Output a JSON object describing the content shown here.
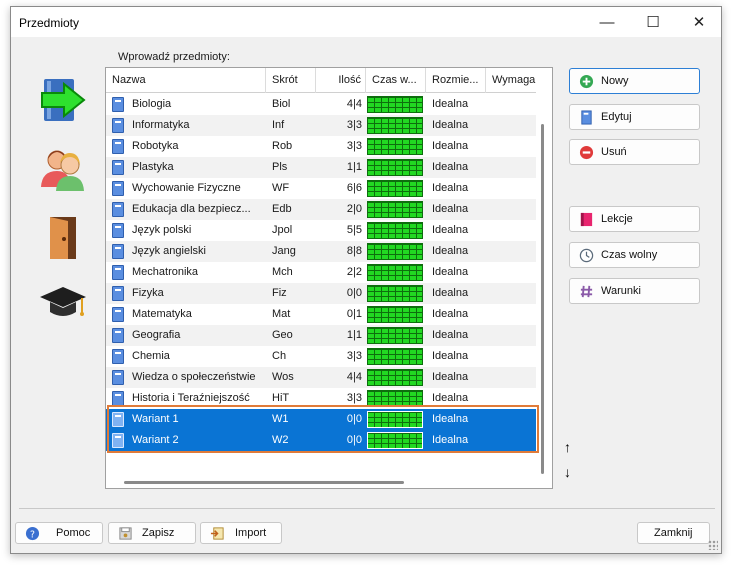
{
  "window": {
    "title": "Przedmioty"
  },
  "titlebar": {
    "minimize": "—",
    "maximize": "☐",
    "close": "✕"
  },
  "list": {
    "label": "Wprowadź przedmioty:",
    "columns": [
      "Nazwa",
      "Skrót",
      "Ilość",
      "Czas w...",
      "Rozmie...",
      "Wymaga"
    ],
    "rows": [
      {
        "name": "Biologia",
        "short": "Biol",
        "count": "4|4",
        "size": "Idealna"
      },
      {
        "name": "Informatyka",
        "short": "Inf",
        "count": "3|3",
        "size": "Idealna"
      },
      {
        "name": "Robotyka",
        "short": "Rob",
        "count": "3|3",
        "size": "Idealna"
      },
      {
        "name": "Plastyka",
        "short": "Pls",
        "count": "1|1",
        "size": "Idealna"
      },
      {
        "name": "Wychowanie Fizyczne",
        "short": "WF",
        "count": "6|6",
        "size": "Idealna"
      },
      {
        "name": "Edukacja dla bezpiecz...",
        "short": "Edb",
        "count": "2|0",
        "size": "Idealna"
      },
      {
        "name": "Język polski",
        "short": "Jpol",
        "count": "5|5",
        "size": "Idealna"
      },
      {
        "name": "Język angielski",
        "short": "Jang",
        "count": "8|8",
        "size": "Idealna"
      },
      {
        "name": "Mechatronika",
        "short": "Mch",
        "count": "2|2",
        "size": "Idealna"
      },
      {
        "name": "Fizyka",
        "short": "Fiz",
        "count": "0|0",
        "size": "Idealna"
      },
      {
        "name": "Matematyka",
        "short": "Mat",
        "count": "0|1",
        "size": "Idealna"
      },
      {
        "name": "Geografia",
        "short": "Geo",
        "count": "1|1",
        "size": "Idealna"
      },
      {
        "name": "Chemia",
        "short": "Ch",
        "count": "3|3",
        "size": "Idealna"
      },
      {
        "name": "Wiedza o społeczeństwie",
        "short": "Wos",
        "count": "4|4",
        "size": "Idealna"
      },
      {
        "name": "Historia i Teraźniejszość",
        "short": "HiT",
        "count": "3|3",
        "size": "Idealna"
      },
      {
        "name": "Wariant 1",
        "short": "W1",
        "count": "0|0",
        "size": "Idealna",
        "selected": true
      },
      {
        "name": "Wariant 2",
        "short": "W2",
        "count": "0|0",
        "size": "Idealna",
        "selected": true
      }
    ]
  },
  "actions": {
    "new": "Nowy",
    "edit": "Edytuj",
    "delete": "Usuń",
    "lessons": "Lekcje",
    "free_time": "Czas wolny",
    "conditions": "Warunki"
  },
  "move": {
    "up": "↑",
    "down": "↓"
  },
  "footer": {
    "help": "Pomoc",
    "save": "Zapisz",
    "import": "Import",
    "close": "Zamknij"
  },
  "colors": {
    "selection": "#0a74d4",
    "outline": "#e07b39",
    "timebar": "#22d822"
  }
}
